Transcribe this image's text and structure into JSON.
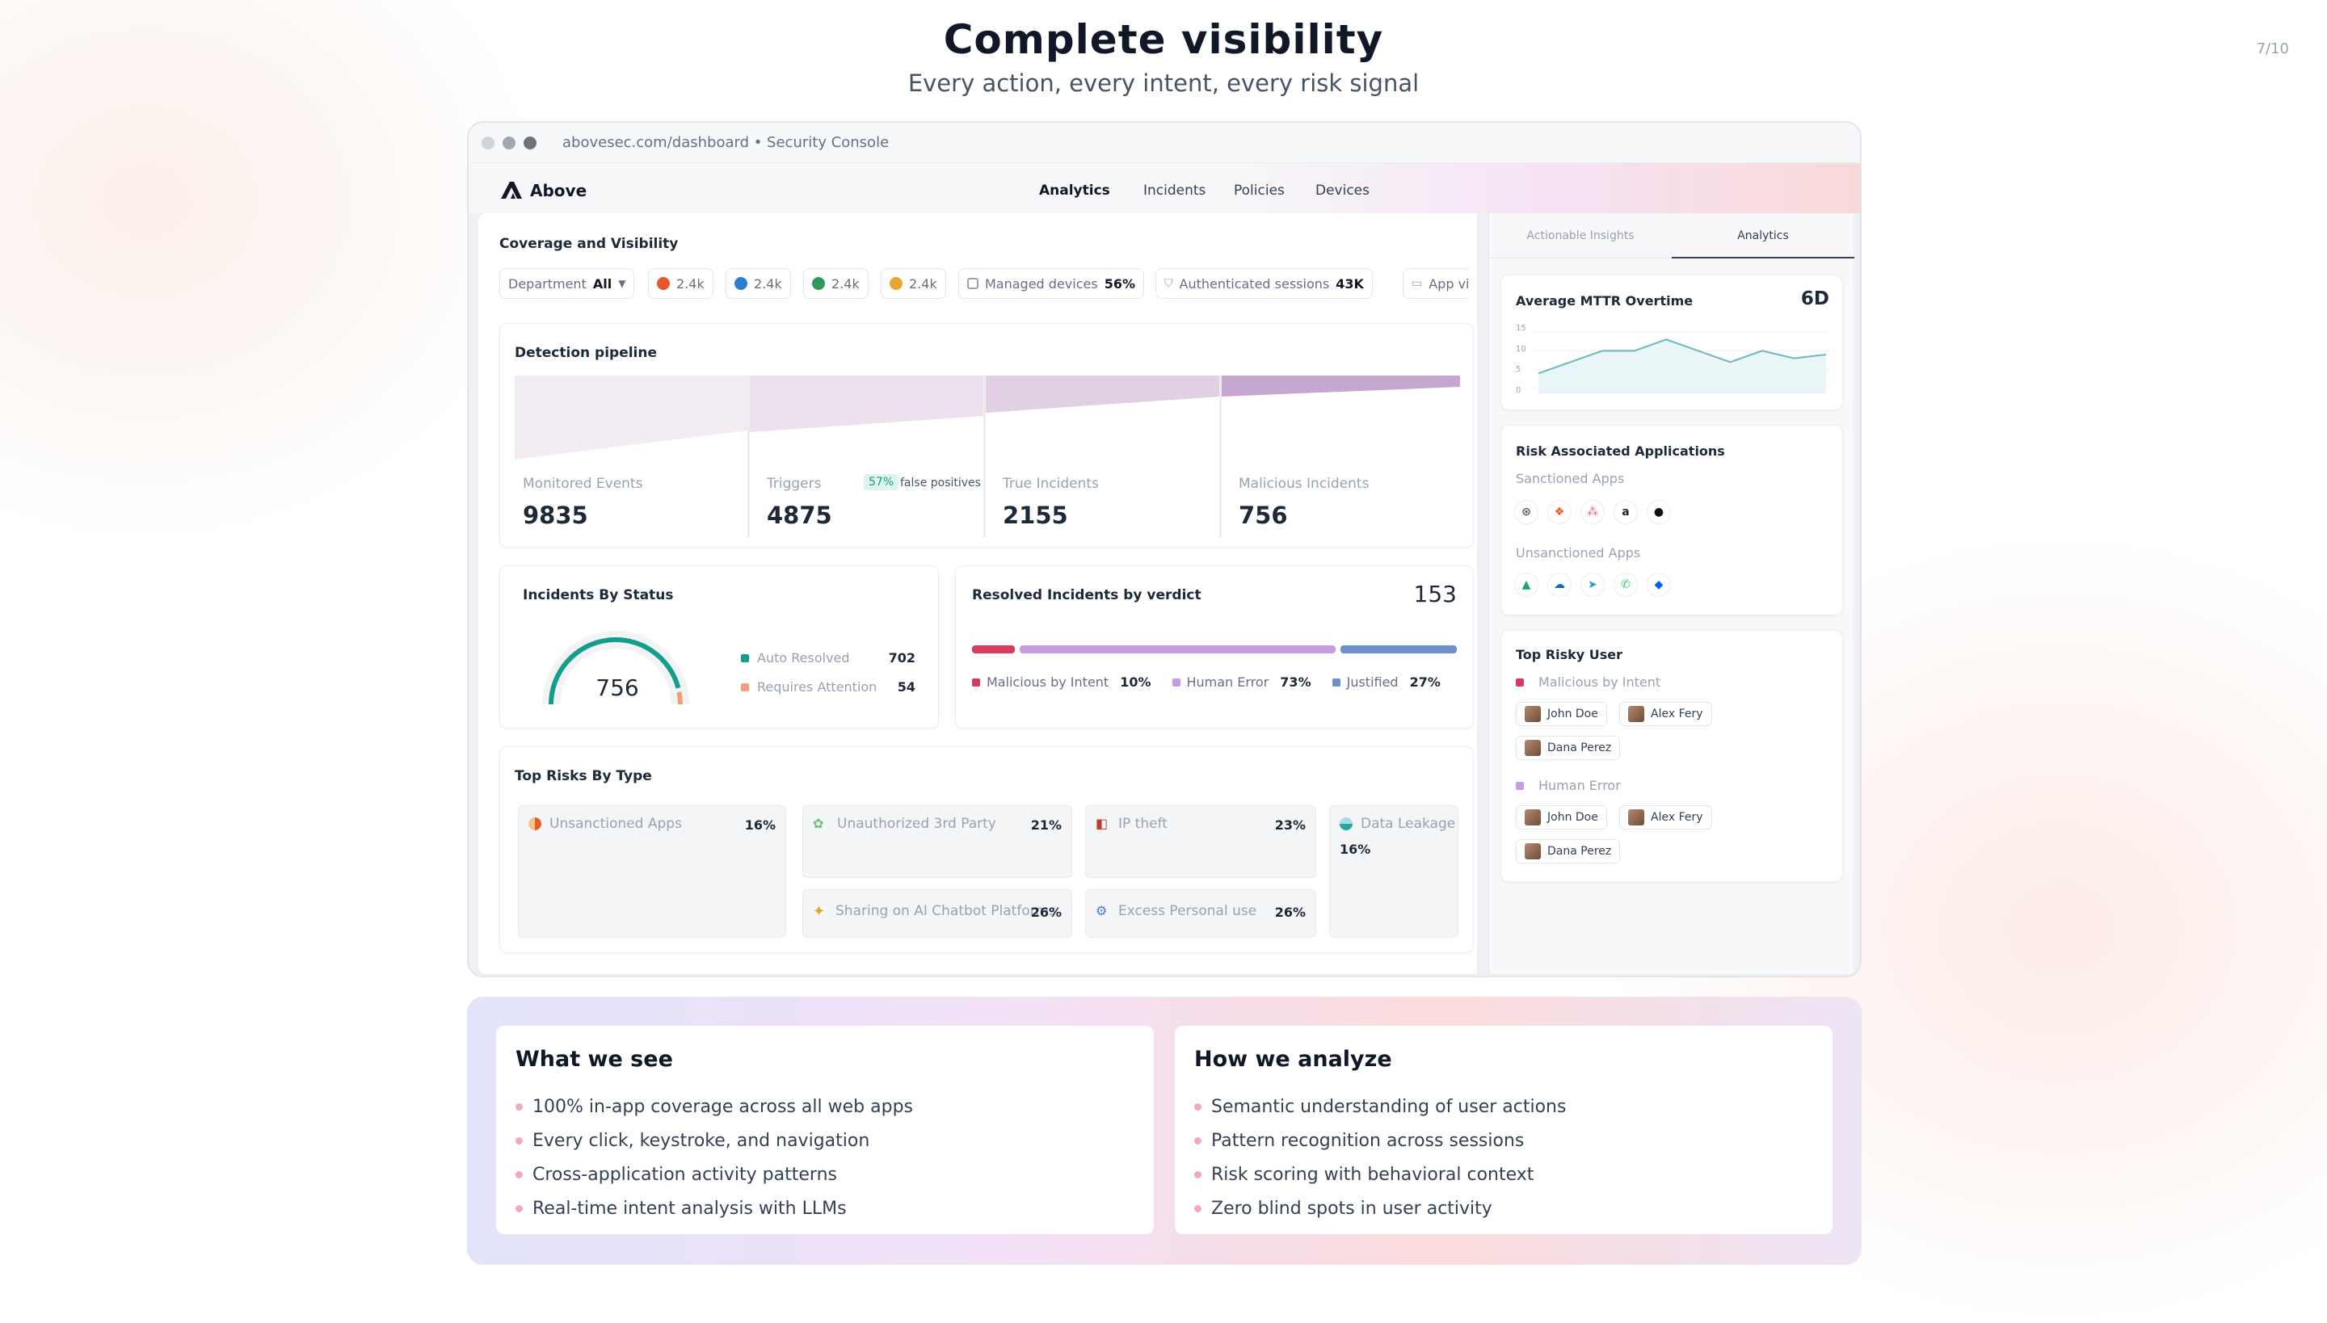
{
  "slide": {
    "title": "Complete visibility",
    "subtitle": "Every action, every intent, every risk signal",
    "page_number": "7/10"
  },
  "browser": {
    "url": "abovesec.com/dashboard • Security Console"
  },
  "app": {
    "logo": "Above",
    "nav": [
      {
        "label": "Analytics",
        "active": true
      },
      {
        "label": "Incidents",
        "active": false
      },
      {
        "label": "Policies",
        "active": false
      },
      {
        "label": "Devices",
        "active": false
      }
    ]
  },
  "coverage": {
    "title": "Coverage and Visibility",
    "department_label": "Department",
    "department_value": "All",
    "browsers": [
      {
        "icon": "firefox-icon",
        "color": "#e8552b",
        "value": "2.4k"
      },
      {
        "icon": "edge-icon",
        "color": "#2f7dd1",
        "value": "2.4k"
      },
      {
        "icon": "browser-icon",
        "color": "#2e9b5b",
        "value": "2.4k"
      },
      {
        "icon": "chrome-icon",
        "color": "#e8a531",
        "value": "2.4k"
      }
    ],
    "managed_label": "Managed devices",
    "managed_value": "56%",
    "auth_label": "Authenticated sessions",
    "auth_value": "43K",
    "app_visibility_label": "App visibil"
  },
  "pipeline": {
    "title": "Detection pipeline",
    "stages": [
      {
        "label": "Monitored Events",
        "value": "9835"
      },
      {
        "label": "Triggers",
        "value": "4875",
        "badge": "57%",
        "badge_note": "false positives"
      },
      {
        "label": "True Incidents",
        "value": "2155"
      },
      {
        "label": "Malicious Incidents",
        "value": "756"
      }
    ]
  },
  "status": {
    "title": "Incidents By Status",
    "total": "756",
    "items": [
      {
        "label": "Auto Resolved",
        "value": "702",
        "color": "#139e8c"
      },
      {
        "label": "Requires Attention",
        "value": "54",
        "color": "#f0a079"
      }
    ]
  },
  "verdict": {
    "title": "Resolved Incidents by verdict",
    "total": "153",
    "items": [
      {
        "label": "Malicious by Intent",
        "pct": "10%",
        "fraction": 0.1,
        "color": "#d93b5c"
      },
      {
        "label": "Human Error",
        "pct": "73%",
        "fraction": 0.73,
        "color": "#c99be0"
      },
      {
        "label": "Justified",
        "pct": "27%",
        "fraction": 0.27,
        "color": "#6f8fc9"
      }
    ]
  },
  "risks": {
    "title": "Top Risks By Type",
    "items": [
      {
        "label": "Unsanctioned Apps",
        "pct": "16%",
        "icon": "unsanctioned-apps-icon"
      },
      {
        "label": "Unauthorized 3rd Party",
        "pct": "21%",
        "icon": "third-party-icon"
      },
      {
        "label": "IP theft",
        "pct": "23%",
        "icon": "ip-theft-icon"
      },
      {
        "label": "Data Leakage",
        "pct": "16%",
        "icon": "data-leakage-icon"
      },
      {
        "label": "Sharing on AI Chatbot Platforms",
        "pct": "26%",
        "icon": "ai-sparkle-icon"
      },
      {
        "label": "Excess Personal use",
        "pct": "26%",
        "icon": "personal-use-icon"
      }
    ]
  },
  "right_panel": {
    "tabs": [
      {
        "label": "Actionable Insights",
        "active": false
      },
      {
        "label": "Analytics",
        "active": true
      }
    ],
    "mttr": {
      "title": "Average MTTR Overtime",
      "value": "6D",
      "yticks": [
        "15",
        "10",
        "5",
        "0"
      ],
      "chart_data": {
        "type": "line",
        "values": [
          4,
          7,
          10,
          10,
          13,
          10,
          7,
          10,
          8,
          9
        ],
        "ylim": [
          0,
          15
        ],
        "color": "#6ab8bf"
      }
    },
    "apps": {
      "title": "Risk Associated Applications",
      "sanctioned_label": "Sanctioned Apps",
      "unsanctioned_label": "Unsanctioned Apps",
      "sanctioned": [
        "openai-icon",
        "figma-icon",
        "asana-icon",
        "amazon-icon",
        "github-icon"
      ],
      "unsanctioned": [
        "google-drive-icon",
        "onedrive-icon",
        "telegram-icon",
        "whatsapp-icon",
        "dropbox-icon"
      ]
    },
    "risky_users": {
      "title": "Top Risky User",
      "groups": [
        {
          "label": "Malicious by Intent",
          "color": "#d93b5c",
          "users": [
            "John Doe",
            "Alex Fery",
            "Dana Perez"
          ]
        },
        {
          "label": "Human Error",
          "color": "#c99be0",
          "users": [
            "John Doe",
            "Alex Fery",
            "Dana Perez"
          ]
        }
      ]
    }
  },
  "what_we_see": {
    "title": "What we see",
    "items": [
      "100% in-app coverage across all web apps",
      "Every click, keystroke, and navigation",
      "Cross-application activity patterns",
      "Real-time intent analysis with LLMs"
    ]
  },
  "how_we_analyze": {
    "title": "How we analyze",
    "items": [
      "Semantic understanding of user actions",
      "Pattern recognition across sessions",
      "Risk scoring with behavioral context",
      "Zero blind spots in user activity"
    ]
  }
}
